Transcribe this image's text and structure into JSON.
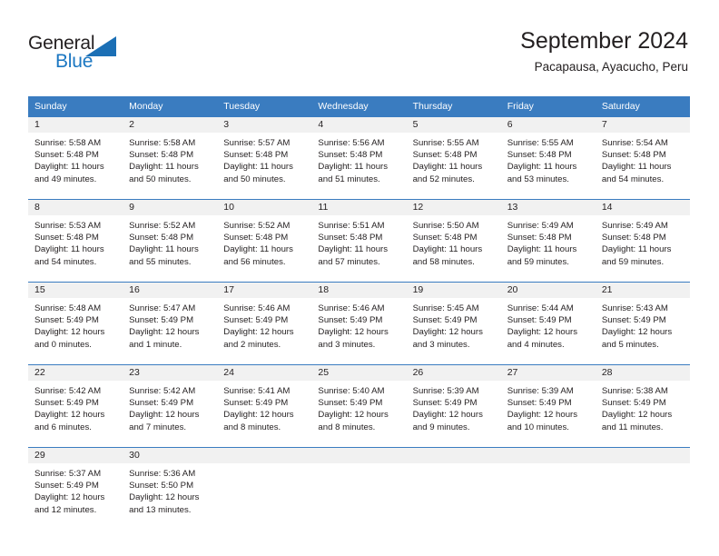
{
  "logo": {
    "word_one": "General",
    "word_two": "Blue",
    "triangle_color": "#1b6fb5",
    "blue_text_color": "#1b77c2"
  },
  "header": {
    "title": "September 2024",
    "subtitle": "Pacapausa, Ayacucho, Peru"
  },
  "theme": {
    "header_row_bg": "#3a7cc0",
    "daynum_band_bg": "#f1f1f1",
    "text_color": "#231f20"
  },
  "weekdays": [
    "Sunday",
    "Monday",
    "Tuesday",
    "Wednesday",
    "Thursday",
    "Friday",
    "Saturday"
  ],
  "labels": {
    "sunrise_prefix": "Sunrise:",
    "sunset_prefix": "Sunset:",
    "daylight_prefix": "Daylight:"
  },
  "weeks": [
    [
      {
        "day": "1",
        "sunrise": "Sunrise: 5:58 AM",
        "sunset": "Sunset: 5:48 PM",
        "daylight_a": "Daylight: 11 hours",
        "daylight_b": "and 49 minutes."
      },
      {
        "day": "2",
        "sunrise": "Sunrise: 5:58 AM",
        "sunset": "Sunset: 5:48 PM",
        "daylight_a": "Daylight: 11 hours",
        "daylight_b": "and 50 minutes."
      },
      {
        "day": "3",
        "sunrise": "Sunrise: 5:57 AM",
        "sunset": "Sunset: 5:48 PM",
        "daylight_a": "Daylight: 11 hours",
        "daylight_b": "and 50 minutes."
      },
      {
        "day": "4",
        "sunrise": "Sunrise: 5:56 AM",
        "sunset": "Sunset: 5:48 PM",
        "daylight_a": "Daylight: 11 hours",
        "daylight_b": "and 51 minutes."
      },
      {
        "day": "5",
        "sunrise": "Sunrise: 5:55 AM",
        "sunset": "Sunset: 5:48 PM",
        "daylight_a": "Daylight: 11 hours",
        "daylight_b": "and 52 minutes."
      },
      {
        "day": "6",
        "sunrise": "Sunrise: 5:55 AM",
        "sunset": "Sunset: 5:48 PM",
        "daylight_a": "Daylight: 11 hours",
        "daylight_b": "and 53 minutes."
      },
      {
        "day": "7",
        "sunrise": "Sunrise: 5:54 AM",
        "sunset": "Sunset: 5:48 PM",
        "daylight_a": "Daylight: 11 hours",
        "daylight_b": "and 54 minutes."
      }
    ],
    [
      {
        "day": "8",
        "sunrise": "Sunrise: 5:53 AM",
        "sunset": "Sunset: 5:48 PM",
        "daylight_a": "Daylight: 11 hours",
        "daylight_b": "and 54 minutes."
      },
      {
        "day": "9",
        "sunrise": "Sunrise: 5:52 AM",
        "sunset": "Sunset: 5:48 PM",
        "daylight_a": "Daylight: 11 hours",
        "daylight_b": "and 55 minutes."
      },
      {
        "day": "10",
        "sunrise": "Sunrise: 5:52 AM",
        "sunset": "Sunset: 5:48 PM",
        "daylight_a": "Daylight: 11 hours",
        "daylight_b": "and 56 minutes."
      },
      {
        "day": "11",
        "sunrise": "Sunrise: 5:51 AM",
        "sunset": "Sunset: 5:48 PM",
        "daylight_a": "Daylight: 11 hours",
        "daylight_b": "and 57 minutes."
      },
      {
        "day": "12",
        "sunrise": "Sunrise: 5:50 AM",
        "sunset": "Sunset: 5:48 PM",
        "daylight_a": "Daylight: 11 hours",
        "daylight_b": "and 58 minutes."
      },
      {
        "day": "13",
        "sunrise": "Sunrise: 5:49 AM",
        "sunset": "Sunset: 5:48 PM",
        "daylight_a": "Daylight: 11 hours",
        "daylight_b": "and 59 minutes."
      },
      {
        "day": "14",
        "sunrise": "Sunrise: 5:49 AM",
        "sunset": "Sunset: 5:48 PM",
        "daylight_a": "Daylight: 11 hours",
        "daylight_b": "and 59 minutes."
      }
    ],
    [
      {
        "day": "15",
        "sunrise": "Sunrise: 5:48 AM",
        "sunset": "Sunset: 5:49 PM",
        "daylight_a": "Daylight: 12 hours",
        "daylight_b": "and 0 minutes."
      },
      {
        "day": "16",
        "sunrise": "Sunrise: 5:47 AM",
        "sunset": "Sunset: 5:49 PM",
        "daylight_a": "Daylight: 12 hours",
        "daylight_b": "and 1 minute."
      },
      {
        "day": "17",
        "sunrise": "Sunrise: 5:46 AM",
        "sunset": "Sunset: 5:49 PM",
        "daylight_a": "Daylight: 12 hours",
        "daylight_b": "and 2 minutes."
      },
      {
        "day": "18",
        "sunrise": "Sunrise: 5:46 AM",
        "sunset": "Sunset: 5:49 PM",
        "daylight_a": "Daylight: 12 hours",
        "daylight_b": "and 3 minutes."
      },
      {
        "day": "19",
        "sunrise": "Sunrise: 5:45 AM",
        "sunset": "Sunset: 5:49 PM",
        "daylight_a": "Daylight: 12 hours",
        "daylight_b": "and 3 minutes."
      },
      {
        "day": "20",
        "sunrise": "Sunrise: 5:44 AM",
        "sunset": "Sunset: 5:49 PM",
        "daylight_a": "Daylight: 12 hours",
        "daylight_b": "and 4 minutes."
      },
      {
        "day": "21",
        "sunrise": "Sunrise: 5:43 AM",
        "sunset": "Sunset: 5:49 PM",
        "daylight_a": "Daylight: 12 hours",
        "daylight_b": "and 5 minutes."
      }
    ],
    [
      {
        "day": "22",
        "sunrise": "Sunrise: 5:42 AM",
        "sunset": "Sunset: 5:49 PM",
        "daylight_a": "Daylight: 12 hours",
        "daylight_b": "and 6 minutes."
      },
      {
        "day": "23",
        "sunrise": "Sunrise: 5:42 AM",
        "sunset": "Sunset: 5:49 PM",
        "daylight_a": "Daylight: 12 hours",
        "daylight_b": "and 7 minutes."
      },
      {
        "day": "24",
        "sunrise": "Sunrise: 5:41 AM",
        "sunset": "Sunset: 5:49 PM",
        "daylight_a": "Daylight: 12 hours",
        "daylight_b": "and 8 minutes."
      },
      {
        "day": "25",
        "sunrise": "Sunrise: 5:40 AM",
        "sunset": "Sunset: 5:49 PM",
        "daylight_a": "Daylight: 12 hours",
        "daylight_b": "and 8 minutes."
      },
      {
        "day": "26",
        "sunrise": "Sunrise: 5:39 AM",
        "sunset": "Sunset: 5:49 PM",
        "daylight_a": "Daylight: 12 hours",
        "daylight_b": "and 9 minutes."
      },
      {
        "day": "27",
        "sunrise": "Sunrise: 5:39 AM",
        "sunset": "Sunset: 5:49 PM",
        "daylight_a": "Daylight: 12 hours",
        "daylight_b": "and 10 minutes."
      },
      {
        "day": "28",
        "sunrise": "Sunrise: 5:38 AM",
        "sunset": "Sunset: 5:49 PM",
        "daylight_a": "Daylight: 12 hours",
        "daylight_b": "and 11 minutes."
      }
    ],
    [
      {
        "day": "29",
        "sunrise": "Sunrise: 5:37 AM",
        "sunset": "Sunset: 5:49 PM",
        "daylight_a": "Daylight: 12 hours",
        "daylight_b": "and 12 minutes."
      },
      {
        "day": "30",
        "sunrise": "Sunrise: 5:36 AM",
        "sunset": "Sunset: 5:50 PM",
        "daylight_a": "Daylight: 12 hours",
        "daylight_b": "and 13 minutes."
      },
      {
        "day": "",
        "sunrise": "",
        "sunset": "",
        "daylight_a": "",
        "daylight_b": ""
      },
      {
        "day": "",
        "sunrise": "",
        "sunset": "",
        "daylight_a": "",
        "daylight_b": ""
      },
      {
        "day": "",
        "sunrise": "",
        "sunset": "",
        "daylight_a": "",
        "daylight_b": ""
      },
      {
        "day": "",
        "sunrise": "",
        "sunset": "",
        "daylight_a": "",
        "daylight_b": ""
      },
      {
        "day": "",
        "sunrise": "",
        "sunset": "",
        "daylight_a": "",
        "daylight_b": ""
      }
    ]
  ]
}
